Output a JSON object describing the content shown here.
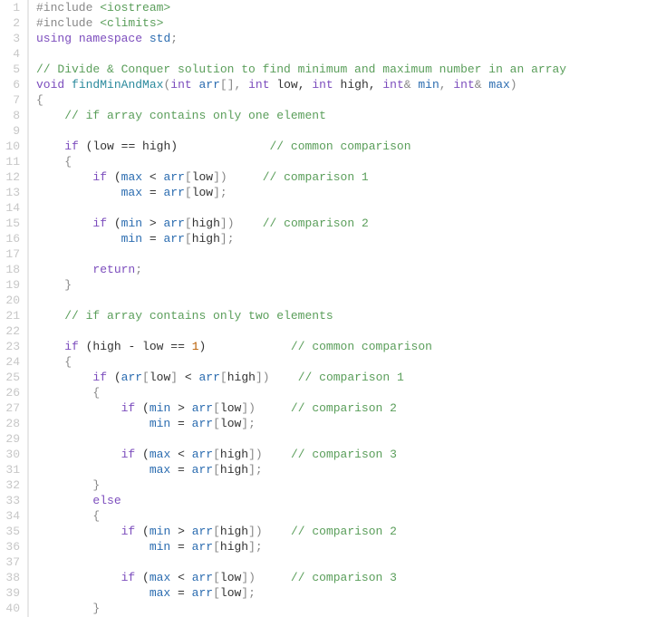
{
  "line_count": 40,
  "code_lines": [
    [
      [
        "pp",
        "#include "
      ],
      [
        "hdr",
        "<iostream>"
      ]
    ],
    [
      [
        "pp",
        "#include "
      ],
      [
        "hdr",
        "<climits>"
      ]
    ],
    [
      [
        "kw",
        "using"
      ],
      [
        "id",
        " "
      ],
      [
        "kw",
        "namespace"
      ],
      [
        "id",
        " "
      ],
      [
        "blue",
        "std"
      ],
      [
        "pun",
        ";"
      ]
    ],
    [],
    [
      [
        "cm",
        "// Divide & Conquer solution to find minimum and maximum number in an array"
      ]
    ],
    [
      [
        "kw",
        "void"
      ],
      [
        "id",
        " "
      ],
      [
        "fn",
        "findMinAndMax"
      ],
      [
        "pun",
        "("
      ],
      [
        "kw",
        "int"
      ],
      [
        "id",
        " "
      ],
      [
        "blue",
        "arr"
      ],
      [
        "pun",
        "[], "
      ],
      [
        "kw",
        "int"
      ],
      [
        "id",
        " low, "
      ],
      [
        "kw",
        "int"
      ],
      [
        "id",
        " high, "
      ],
      [
        "kw",
        "int"
      ],
      [
        "pun",
        "& "
      ],
      [
        "blue",
        "min"
      ],
      [
        "pun",
        ", "
      ],
      [
        "kw",
        "int"
      ],
      [
        "pun",
        "& "
      ],
      [
        "blue",
        "max"
      ],
      [
        "pun",
        ")"
      ]
    ],
    [
      [
        "pun",
        "{"
      ]
    ],
    [
      [
        "id",
        "    "
      ],
      [
        "cm",
        "// if array contains only one element"
      ]
    ],
    [],
    [
      [
        "id",
        "    "
      ],
      [
        "kw",
        "if"
      ],
      [
        "id",
        " (low "
      ],
      [
        "op",
        "=="
      ],
      [
        "id",
        " high)             "
      ],
      [
        "cm",
        "// common comparison"
      ]
    ],
    [
      [
        "id",
        "    "
      ],
      [
        "pun",
        "{"
      ]
    ],
    [
      [
        "id",
        "        "
      ],
      [
        "kw",
        "if"
      ],
      [
        "id",
        " ("
      ],
      [
        "blue",
        "max"
      ],
      [
        "id",
        " "
      ],
      [
        "op",
        "<"
      ],
      [
        "id",
        " "
      ],
      [
        "blue",
        "arr"
      ],
      [
        "pun",
        "["
      ],
      [
        "id",
        "low"
      ],
      [
        "pun",
        "])     "
      ],
      [
        "cm",
        "// comparison 1"
      ]
    ],
    [
      [
        "id",
        "            "
      ],
      [
        "blue",
        "max"
      ],
      [
        "id",
        " "
      ],
      [
        "op",
        "="
      ],
      [
        "id",
        " "
      ],
      [
        "blue",
        "arr"
      ],
      [
        "pun",
        "["
      ],
      [
        "id",
        "low"
      ],
      [
        "pun",
        "];"
      ]
    ],
    [],
    [
      [
        "id",
        "        "
      ],
      [
        "kw",
        "if"
      ],
      [
        "id",
        " ("
      ],
      [
        "blue",
        "min"
      ],
      [
        "id",
        " "
      ],
      [
        "op",
        ">"
      ],
      [
        "id",
        " "
      ],
      [
        "blue",
        "arr"
      ],
      [
        "pun",
        "["
      ],
      [
        "id",
        "high"
      ],
      [
        "pun",
        "])    "
      ],
      [
        "cm",
        "// comparison 2"
      ]
    ],
    [
      [
        "id",
        "            "
      ],
      [
        "blue",
        "min"
      ],
      [
        "id",
        " "
      ],
      [
        "op",
        "="
      ],
      [
        "id",
        " "
      ],
      [
        "blue",
        "arr"
      ],
      [
        "pun",
        "["
      ],
      [
        "id",
        "high"
      ],
      [
        "pun",
        "];"
      ]
    ],
    [],
    [
      [
        "id",
        "        "
      ],
      [
        "kw",
        "return"
      ],
      [
        "pun",
        ";"
      ]
    ],
    [
      [
        "id",
        "    "
      ],
      [
        "pun",
        "}"
      ]
    ],
    [],
    [
      [
        "id",
        "    "
      ],
      [
        "cm",
        "// if array contains only two elements"
      ]
    ],
    [],
    [
      [
        "id",
        "    "
      ],
      [
        "kw",
        "if"
      ],
      [
        "id",
        " (high "
      ],
      [
        "op",
        "-"
      ],
      [
        "id",
        " low "
      ],
      [
        "op",
        "=="
      ],
      [
        "id",
        " "
      ],
      [
        "num",
        "1"
      ],
      [
        "id",
        ")            "
      ],
      [
        "cm",
        "// common comparison"
      ]
    ],
    [
      [
        "id",
        "    "
      ],
      [
        "pun",
        "{"
      ]
    ],
    [
      [
        "id",
        "        "
      ],
      [
        "kw",
        "if"
      ],
      [
        "id",
        " ("
      ],
      [
        "blue",
        "arr"
      ],
      [
        "pun",
        "["
      ],
      [
        "id",
        "low"
      ],
      [
        "pun",
        "] "
      ],
      [
        "op",
        "<"
      ],
      [
        "id",
        " "
      ],
      [
        "blue",
        "arr"
      ],
      [
        "pun",
        "["
      ],
      [
        "id",
        "high"
      ],
      [
        "pun",
        "])    "
      ],
      [
        "cm",
        "// comparison 1"
      ]
    ],
    [
      [
        "id",
        "        "
      ],
      [
        "pun",
        "{"
      ]
    ],
    [
      [
        "id",
        "            "
      ],
      [
        "kw",
        "if"
      ],
      [
        "id",
        " ("
      ],
      [
        "blue",
        "min"
      ],
      [
        "id",
        " "
      ],
      [
        "op",
        ">"
      ],
      [
        "id",
        " "
      ],
      [
        "blue",
        "arr"
      ],
      [
        "pun",
        "["
      ],
      [
        "id",
        "low"
      ],
      [
        "pun",
        "])     "
      ],
      [
        "cm",
        "// comparison 2"
      ]
    ],
    [
      [
        "id",
        "                "
      ],
      [
        "blue",
        "min"
      ],
      [
        "id",
        " "
      ],
      [
        "op",
        "="
      ],
      [
        "id",
        " "
      ],
      [
        "blue",
        "arr"
      ],
      [
        "pun",
        "["
      ],
      [
        "id",
        "low"
      ],
      [
        "pun",
        "];"
      ]
    ],
    [],
    [
      [
        "id",
        "            "
      ],
      [
        "kw",
        "if"
      ],
      [
        "id",
        " ("
      ],
      [
        "blue",
        "max"
      ],
      [
        "id",
        " "
      ],
      [
        "op",
        "<"
      ],
      [
        "id",
        " "
      ],
      [
        "blue",
        "arr"
      ],
      [
        "pun",
        "["
      ],
      [
        "id",
        "high"
      ],
      [
        "pun",
        "])    "
      ],
      [
        "cm",
        "// comparison 3"
      ]
    ],
    [
      [
        "id",
        "                "
      ],
      [
        "blue",
        "max"
      ],
      [
        "id",
        " "
      ],
      [
        "op",
        "="
      ],
      [
        "id",
        " "
      ],
      [
        "blue",
        "arr"
      ],
      [
        "pun",
        "["
      ],
      [
        "id",
        "high"
      ],
      [
        "pun",
        "];"
      ]
    ],
    [
      [
        "id",
        "        "
      ],
      [
        "pun",
        "}"
      ]
    ],
    [
      [
        "id",
        "        "
      ],
      [
        "kw",
        "else"
      ]
    ],
    [
      [
        "id",
        "        "
      ],
      [
        "pun",
        "{"
      ]
    ],
    [
      [
        "id",
        "            "
      ],
      [
        "kw",
        "if"
      ],
      [
        "id",
        " ("
      ],
      [
        "blue",
        "min"
      ],
      [
        "id",
        " "
      ],
      [
        "op",
        ">"
      ],
      [
        "id",
        " "
      ],
      [
        "blue",
        "arr"
      ],
      [
        "pun",
        "["
      ],
      [
        "id",
        "high"
      ],
      [
        "pun",
        "])    "
      ],
      [
        "cm",
        "// comparison 2"
      ]
    ],
    [
      [
        "id",
        "                "
      ],
      [
        "blue",
        "min"
      ],
      [
        "id",
        " "
      ],
      [
        "op",
        "="
      ],
      [
        "id",
        " "
      ],
      [
        "blue",
        "arr"
      ],
      [
        "pun",
        "["
      ],
      [
        "id",
        "high"
      ],
      [
        "pun",
        "];"
      ]
    ],
    [],
    [
      [
        "id",
        "            "
      ],
      [
        "kw",
        "if"
      ],
      [
        "id",
        " ("
      ],
      [
        "blue",
        "max"
      ],
      [
        "id",
        " "
      ],
      [
        "op",
        "<"
      ],
      [
        "id",
        " "
      ],
      [
        "blue",
        "arr"
      ],
      [
        "pun",
        "["
      ],
      [
        "id",
        "low"
      ],
      [
        "pun",
        "])     "
      ],
      [
        "cm",
        "// comparison 3"
      ]
    ],
    [
      [
        "id",
        "                "
      ],
      [
        "blue",
        "max"
      ],
      [
        "id",
        " "
      ],
      [
        "op",
        "="
      ],
      [
        "id",
        " "
      ],
      [
        "blue",
        "arr"
      ],
      [
        "pun",
        "["
      ],
      [
        "id",
        "low"
      ],
      [
        "pun",
        "];"
      ]
    ],
    [
      [
        "id",
        "        "
      ],
      [
        "pun",
        "}"
      ]
    ]
  ]
}
